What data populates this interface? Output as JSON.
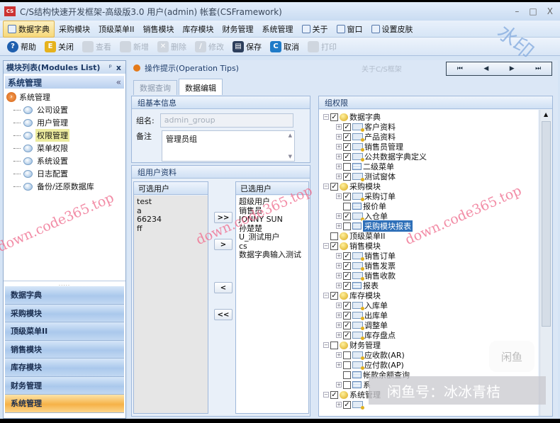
{
  "window": {
    "title": "C/S结构快速开发框架-高级版3.0 用户(admin) 帐套(CSFramework)",
    "icon_text": "CS",
    "min": "–",
    "max": "□",
    "close": "X"
  },
  "menu": [
    "数据字典",
    "采购模块",
    "顶级菜单II",
    "销售模块",
    "库存模块",
    "财务管理",
    "系统管理",
    "关于",
    "窗口",
    "设置皮肤"
  ],
  "toolbar": [
    {
      "label": "帮助",
      "enabled": true,
      "icon": "help-icon",
      "color": "#1f5fae",
      "glyph": "?"
    },
    {
      "label": "关闭",
      "enabled": true,
      "icon": "exit-icon",
      "color": "#e6b21c",
      "glyph": "E"
    },
    {
      "label": "查看",
      "enabled": false,
      "icon": "view-icon",
      "color": "#cfd6df",
      "glyph": ""
    },
    {
      "label": "新增",
      "enabled": false,
      "icon": "new-icon",
      "color": "#cfd6df",
      "glyph": ""
    },
    {
      "label": "删除",
      "enabled": false,
      "icon": "delete-icon",
      "color": "#cfd6df",
      "glyph": "✕"
    },
    {
      "label": "修改",
      "enabled": false,
      "icon": "edit-icon",
      "color": "#cfd6df",
      "glyph": "/"
    },
    {
      "label": "保存",
      "enabled": true,
      "icon": "save-icon",
      "color": "#2d3f5c",
      "glyph": "▤"
    },
    {
      "label": "取消",
      "enabled": true,
      "icon": "cancel-icon",
      "color": "#1f7bc8",
      "glyph": "C"
    },
    {
      "label": "打印",
      "enabled": false,
      "icon": "print-icon",
      "color": "#cfd6df",
      "glyph": ""
    }
  ],
  "left": {
    "title": "模块列表(Modules List)",
    "pin": "ᵖ",
    "close": "x",
    "group": "系统管理",
    "collapse": "«",
    "root": "系统管理",
    "items": [
      {
        "label": "公司设置"
      },
      {
        "label": "用户管理"
      },
      {
        "label": "权限管理",
        "selected": true
      },
      {
        "label": "菜单权限"
      },
      {
        "label": "系统设置"
      },
      {
        "label": "日志配置"
      },
      {
        "label": "备份/还原数据库"
      }
    ],
    "splitter": ".....",
    "nav": [
      "数据字典",
      "采购模块",
      "顶级菜单II",
      "销售模块",
      "库存模块",
      "财务管理",
      "系统管理"
    ],
    "nav_active": "系统管理"
  },
  "main": {
    "tips": "操作提示(Operation Tips)",
    "about": "关于C/S框架",
    "pager": [
      "⏮",
      "◀",
      "▶",
      "⏭"
    ],
    "tabs": [
      "数据查询",
      "数据编辑"
    ],
    "active_tab": "数据编辑",
    "basic": {
      "title": "组基本信息",
      "name_label": "组名:",
      "name_value": "admin_group",
      "note_label": "备注",
      "note_value": "管理员组"
    },
    "users": {
      "title": "组用户资料",
      "available_title": "可选用户",
      "available": [
        "test",
        "a",
        "66234",
        "ff"
      ],
      "selected_title": "已选用户",
      "selected": [
        "超级用户",
        "销售员",
        "JONNY SUN",
        "孙楚楚",
        "U_测试用户",
        "cs",
        "数据字典输入测试"
      ],
      "buttons": [
        ">>",
        ">",
        "<",
        "<<"
      ]
    },
    "perm": {
      "title": "组权限",
      "tree": [
        {
          "l": 0,
          "t": "数据字典",
          "c": true,
          "i": "folder",
          "e": "-"
        },
        {
          "l": 1,
          "t": "客户资料",
          "c": true,
          "i": "form",
          "e": "+"
        },
        {
          "l": 1,
          "t": "产品资料",
          "c": true,
          "i": "form",
          "e": "+"
        },
        {
          "l": 1,
          "t": "销售员管理",
          "c": true,
          "i": "form",
          "e": "+"
        },
        {
          "l": 1,
          "t": "公共数据字典定义",
          "c": true,
          "i": "form",
          "e": "+"
        },
        {
          "l": 1,
          "t": "二级菜单",
          "c": false,
          "i": "report",
          "e": "+"
        },
        {
          "l": 1,
          "t": "测试窗体",
          "c": true,
          "i": "form",
          "e": "+"
        },
        {
          "l": 0,
          "t": "采购模块",
          "c": true,
          "i": "folder",
          "e": "-"
        },
        {
          "l": 1,
          "t": "采购订单",
          "c": true,
          "i": "form",
          "e": "+"
        },
        {
          "l": 1,
          "t": "报价单",
          "c": false,
          "i": "report",
          "e": ""
        },
        {
          "l": 1,
          "t": "入仓单",
          "c": true,
          "i": "form",
          "e": "+"
        },
        {
          "l": 1,
          "t": "采购模块报表",
          "c": false,
          "i": "report",
          "e": "+",
          "sel": true
        },
        {
          "l": 0,
          "t": "顶级菜单II",
          "c": false,
          "i": "folder",
          "e": ""
        },
        {
          "l": 0,
          "t": "销售模块",
          "c": true,
          "i": "folder",
          "e": "-"
        },
        {
          "l": 1,
          "t": "销售订单",
          "c": true,
          "i": "form",
          "e": "+"
        },
        {
          "l": 1,
          "t": "销售发票",
          "c": true,
          "i": "form",
          "e": "+"
        },
        {
          "l": 1,
          "t": "销售收款",
          "c": true,
          "i": "form",
          "e": "+"
        },
        {
          "l": 1,
          "t": "报表",
          "c": true,
          "i": "report",
          "e": "+"
        },
        {
          "l": 0,
          "t": "库存模块",
          "c": true,
          "i": "folder",
          "e": "-"
        },
        {
          "l": 1,
          "t": "入库单",
          "c": true,
          "i": "form",
          "e": "+"
        },
        {
          "l": 1,
          "t": "出库单",
          "c": true,
          "i": "form",
          "e": "+"
        },
        {
          "l": 1,
          "t": "调整单",
          "c": true,
          "i": "form",
          "e": "+"
        },
        {
          "l": 1,
          "t": "库存盘点",
          "c": true,
          "i": "form",
          "e": "+"
        },
        {
          "l": 0,
          "t": "财务管理",
          "c": false,
          "i": "folder",
          "e": "-"
        },
        {
          "l": 1,
          "t": "应收款(AR)",
          "c": false,
          "i": "form",
          "e": "+"
        },
        {
          "l": 1,
          "t": "应付款(AP)",
          "c": false,
          "i": "form",
          "e": "+"
        },
        {
          "l": 1,
          "t": "帐款余额查询",
          "c": false,
          "i": "report",
          "e": ""
        },
        {
          "l": 1,
          "t": "系",
          "c": false,
          "i": "report",
          "e": "+"
        },
        {
          "l": 0,
          "t": "系统管理",
          "c": true,
          "i": "folder",
          "e": "-"
        },
        {
          "l": 1,
          "t": "",
          "c": true,
          "i": "form",
          "e": "+"
        }
      ]
    }
  },
  "watermarks": {
    "site": "down.code365.top",
    "stamp": "水印",
    "overlay": "闲鱼号：冰冰青桔",
    "seal": "闲鱼"
  }
}
